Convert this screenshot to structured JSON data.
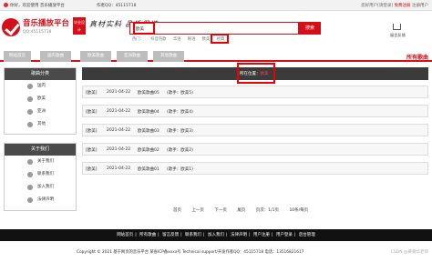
{
  "topbar": {
    "welcome": "你好，欢迎使用 音乐播放平台",
    "qq": "作者QQ：45115718",
    "login": "您好用户[请登录]",
    "register": "免费注册",
    "register_link": "注册用户"
  },
  "header": {
    "logo_title": "音乐播放平台",
    "logo_qq": "QQ:45115718",
    "logo_tag": "毕业设计",
    "slogan": "真材实料 品质保证",
    "search_value": "欧美",
    "search_button": "搜索",
    "hotwords": [
      "热门：",
      "抖音热歌",
      "华语",
      "韩语",
      "欧美",
      "经典"
    ],
    "cart_label": "留言反馈"
  },
  "nav": {
    "items": [
      "网站首页",
      "国内歌曲",
      "欧美歌曲",
      "亚洲歌曲",
      "其他歌曲"
    ],
    "all_songs": "所有歌曲"
  },
  "sidebar": {
    "category_title": "歌曲分类",
    "categories": [
      "国内",
      "欧美",
      "亚洲",
      "其他"
    ],
    "about_title": "关于我们",
    "about_items": [
      "关于我们",
      "联系我们",
      "加入我们",
      "法律声明"
    ]
  },
  "main": {
    "position_label": "所在位置：",
    "position_value": "欧美",
    "rows": [
      {
        "tag": "[欧美]",
        "date": "2021-04-22",
        "song": "欧美歌曲05",
        "singer": "(歌手：欧美5)"
      },
      {
        "tag": "[欧美]",
        "date": "2021-04-22",
        "song": "欧美歌曲04",
        "singer": "(歌手：欧美4)"
      },
      {
        "tag": "[欧美]",
        "date": "2021-04-22",
        "song": "欧美歌曲03",
        "singer": "(歌手：欧美3)"
      },
      {
        "tag": "[欧美]",
        "date": "2021-04-22",
        "song": "欧美歌曲02",
        "singer": "(歌手：欧美2)"
      },
      {
        "tag": "[欧美]",
        "date": "2021-04-22",
        "song": "欧美歌曲01",
        "singer": "(歌手：欧美1)"
      }
    ],
    "pager": [
      "首页",
      "上一页",
      "下一页",
      "尾页",
      "页次：1/1页",
      "10条/每页"
    ]
  },
  "footer": {
    "nav": [
      "网站首页",
      "所有歌曲",
      "留言反馈",
      "联系我们",
      "加入我们",
      "法律声明",
      "用户注册",
      "用户登录",
      "后台管理"
    ],
    "copyright": "Copyright © 2021 基于网页的音乐平台  某省ICP备xxxx号  Technical support/开发作者QQ：45115718  电话：13516821617",
    "watermark": "CSDN @黄菊华老师"
  },
  "colors": {
    "brand": "#d40f17",
    "dark": "#3b3b3b",
    "highlight": "#e00000"
  }
}
